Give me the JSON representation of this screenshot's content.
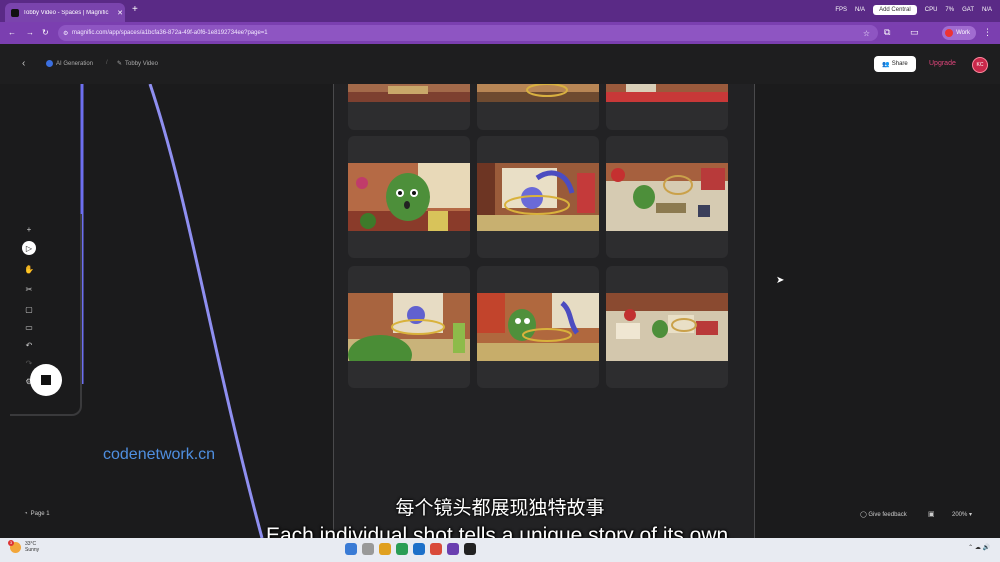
{
  "browser": {
    "tab_title": "Tobby Video - Spaces | Magnific",
    "new_tab": "+",
    "url": "magnific.com/app/spaces/a1bcfa36-872a-49f-a0f6-1e8192734ee?page=1",
    "profile_label": "Work",
    "monitor": {
      "fps_label": "FPS",
      "fps_value": "N/A",
      "job_label": "Add Central",
      "cpu_label": "CPU",
      "cpu_value": "7%",
      "gpu_label": "GAT",
      "gpu_value": "N/A"
    }
  },
  "header": {
    "breadcrumb_parent": "AI Generation",
    "breadcrumb_current": "Tobby Video",
    "share_label": "Share",
    "upgrade_label": "Upgrade",
    "avatar_initials": "KC"
  },
  "canvas": {
    "watermark": "codenetwork.cn",
    "page_label": "Page 1",
    "feedback_label": "Give feedback",
    "zoom_label": "200%"
  },
  "subtitles": {
    "cn": "每个镜头都展现独特故事",
    "en": "Each individual shot tells a unique story of its own."
  },
  "taskbar": {
    "weather_temp": "33°C",
    "weather_desc": "Sunny",
    "badge": "3"
  },
  "colors": {
    "tab_strip": "#5a2a86",
    "address_bar": "#7b3fb0",
    "wire": "#8f8ff0",
    "upgrade": "#e0457b",
    "watermark": "#4f8fe0"
  }
}
